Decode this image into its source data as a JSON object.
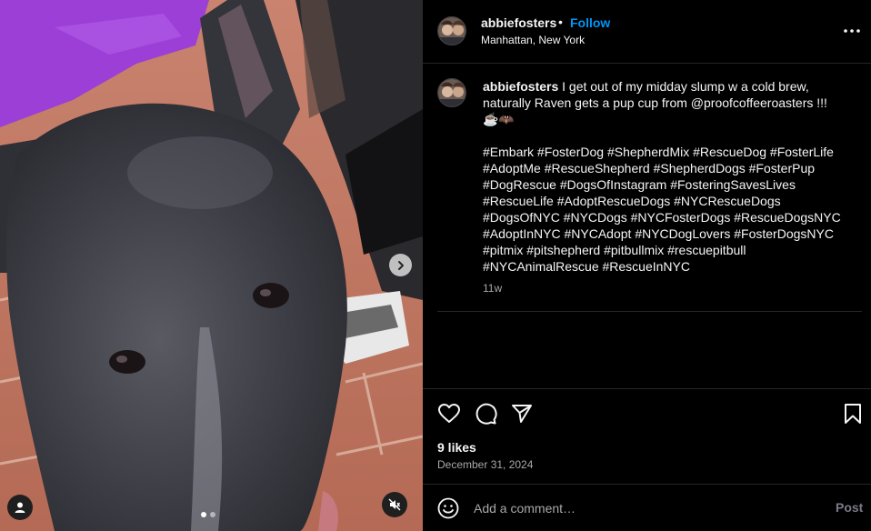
{
  "post": {
    "username": "abbiefosters",
    "separator": "•",
    "follow_label": "Follow",
    "location": "Manhattan, New York",
    "more_icon": "more-horizontal-icon"
  },
  "caption": {
    "username": "abbiefosters",
    "text": " I get out of my midday slump w a cold brew, naturally Raven gets a pup cup from @proofcoffeeroasters !!! ☕️🦇\n\n#Embark #FosterDog #ShepherdMix #RescueDog #FosterLife #AdoptMe #RescueShepherd #ShepherdDogs #FosterPup #DogRescue #DogsOfInstagram #FosteringSavesLives #RescueLife #AdoptRescueDogs #NYCRescueDogs #DogsOfNYC #NYCDogs #NYCFosterDogs #RescueDogsNYC #AdoptInNYC #NYCAdopt #NYCDogLovers #FosterDogsNYC #pitmix #pitshepherd #pitbullmix #rescuepitbull #NYCAnimalRescue #RescueInNYC",
    "time_ago": "11w"
  },
  "engagement": {
    "likes": "9 likes",
    "date": "December 31, 2024"
  },
  "comment": {
    "placeholder": "Add a comment…",
    "post_label": "Post"
  },
  "media": {
    "carousel_total": 2,
    "carousel_active": 1
  },
  "colors": {
    "accent": "#0095f6",
    "background": "#000000",
    "text": "#f5f5f5",
    "muted": "#a8a8a8",
    "divider": "#262626"
  }
}
